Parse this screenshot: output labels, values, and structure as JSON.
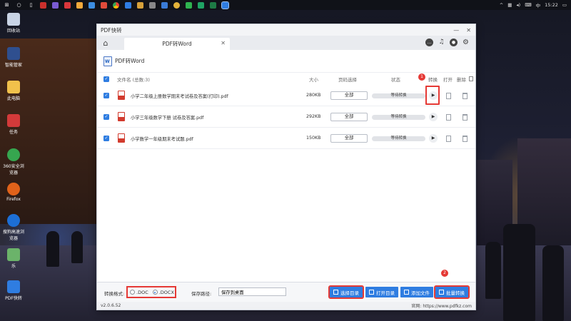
{
  "taskbar": {
    "time": "15:22",
    "ime": "中",
    "tray_icons": [
      "up-arrow-icon",
      "network-icon",
      "volume-icon",
      "input-icon"
    ],
    "pinned": [
      "windows-logo-icon",
      "cortana-icon",
      "task-view-icon",
      "app1-icon",
      "app2-icon",
      "app3-icon",
      "app4-icon",
      "app5-icon",
      "app6-icon",
      "chrome-icon",
      "app8-icon",
      "app9-icon",
      "app10-icon",
      "app11-icon",
      "app12-icon",
      "app13-icon",
      "app14-icon",
      "app15-icon",
      "pdf-app-icon"
    ]
  },
  "desktop": {
    "icons": [
      {
        "label": "回收站",
        "color": "#c9d4e6"
      },
      {
        "label": "智能管家",
        "color": "#2f4f8f"
      },
      {
        "label": "此电脑",
        "color": "#f1c14b"
      },
      {
        "label": "任务",
        "color": "#d33a3a"
      },
      {
        "label": "360安全浏览器",
        "color": "#36a64f"
      },
      {
        "label": "Firefox",
        "color": "#e0621a"
      },
      {
        "label": "搜狗高速浏览器",
        "color": "#1d6fd6"
      },
      {
        "label": "乐",
        "color": "#6bb36a"
      },
      {
        "label": "PDF快转",
        "color": "#2f7de1"
      }
    ]
  },
  "app": {
    "title": "PDF快转",
    "tab_label": "PDF转Word",
    "section_title": "PDF转Word",
    "table": {
      "col_filename": "文件名 (总数:3)",
      "col_size": "大小",
      "col_range": "页码选择",
      "col_status": "状态",
      "col_convert": "转换",
      "col_open": "打开",
      "col_delete": "删除",
      "rows": [
        {
          "name": "小学二年级上册数学期末考试卷及答案(打印).pdf",
          "size": "280KB",
          "range": "全部",
          "status": "等待转换"
        },
        {
          "name": "小学三年级数学下册 试卷及答案.pdf",
          "size": "292KB",
          "range": "全部",
          "status": "等待转换"
        },
        {
          "name": "小学数学一年级期末考试题.pdf",
          "size": "150KB",
          "range": "全部",
          "status": "等待转换"
        }
      ]
    },
    "bottom": {
      "format_label": "转换格式:",
      "format_doc": ".DOC",
      "format_docx": ".DOCX",
      "format_selected": ".DOCX",
      "save_label": "保存路径:",
      "save_value": "保存到桌面",
      "btn_choose_dir": "选择目录",
      "btn_open_dir": "打开目录",
      "btn_add_file": "添加文件",
      "btn_batch": "批量转换"
    },
    "version": "v2.0.6.52",
    "website": "官网: https://www.pdfkz.com",
    "markers": [
      "1",
      "2"
    ]
  },
  "colors": {
    "accent": "#2f7de1",
    "highlight": "#e53935"
  }
}
